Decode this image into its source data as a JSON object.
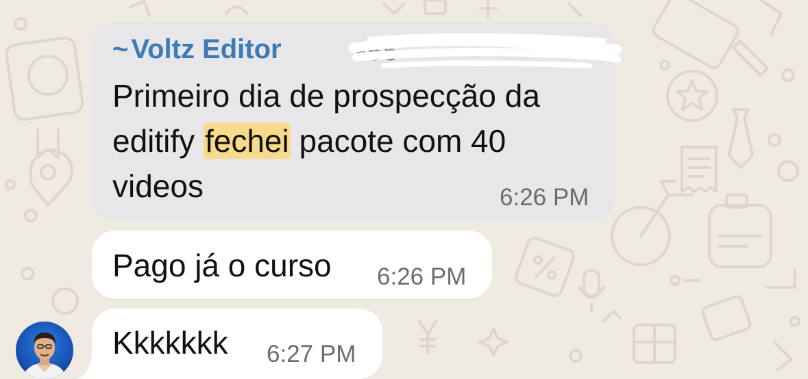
{
  "messages": [
    {
      "sender_prefix": "~",
      "sender_name": "Voltz Editor",
      "sender_phone": "+55",
      "text_line1": "Primeiro dia de prospecção da",
      "text_line2_before": "editify ",
      "text_line2_highlight": "fechei",
      "text_line2_after": " pacote com 40",
      "text_line3": "videos",
      "time": "6:26 PM"
    },
    {
      "text": "Pago já o curso",
      "time": "6:26 PM"
    },
    {
      "text": "Kkkkkkk",
      "time": "6:27 PM"
    }
  ],
  "colors": {
    "background": "#efeae2",
    "quoted_bubble": "#e7e6e9",
    "sender_name": "#3c7ab8",
    "highlight": "#f9d98a",
    "avatar": "#1a55b8"
  }
}
